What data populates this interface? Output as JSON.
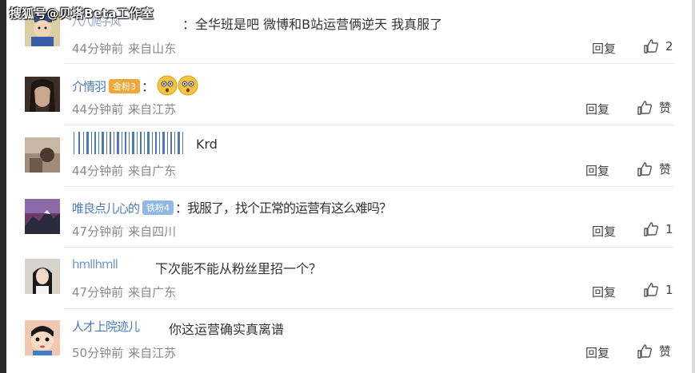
{
  "watermark": "搜狐号@贝塔Beta工作室",
  "labels": {
    "reply": "回复"
  },
  "comments": [
    {
      "user": "八八爬子风",
      "text": "：全华班是吧 微博和B站运营俩逆天 我真服了",
      "time": "44分钟前",
      "location": "来自山东",
      "likes": "2"
    },
    {
      "user": "介情羽",
      "badge": "金粉3",
      "text": "：",
      "time": "44分钟前",
      "location": "来自江苏",
      "likes": "赞"
    },
    {
      "text": "Krd",
      "time": "44分钟前",
      "location": "来自广东",
      "likes": "赞"
    },
    {
      "user": "唯良点儿心的",
      "badge": "铁粉4",
      "text": "：我服了，找个正常的运营有这么难吗？",
      "time": "47分钟前",
      "location": "来自四川",
      "likes": "1"
    },
    {
      "user": "hmllhmll",
      "text": "下次能不能从粉丝里招一个？",
      "time": "47分钟前",
      "location": "来自广东",
      "likes": "1"
    },
    {
      "user": "人才上院迹儿",
      "text": "你这运营确实真离谱",
      "time": "50分钟前",
      "location": "来自江苏",
      "likes": "赞"
    }
  ]
}
